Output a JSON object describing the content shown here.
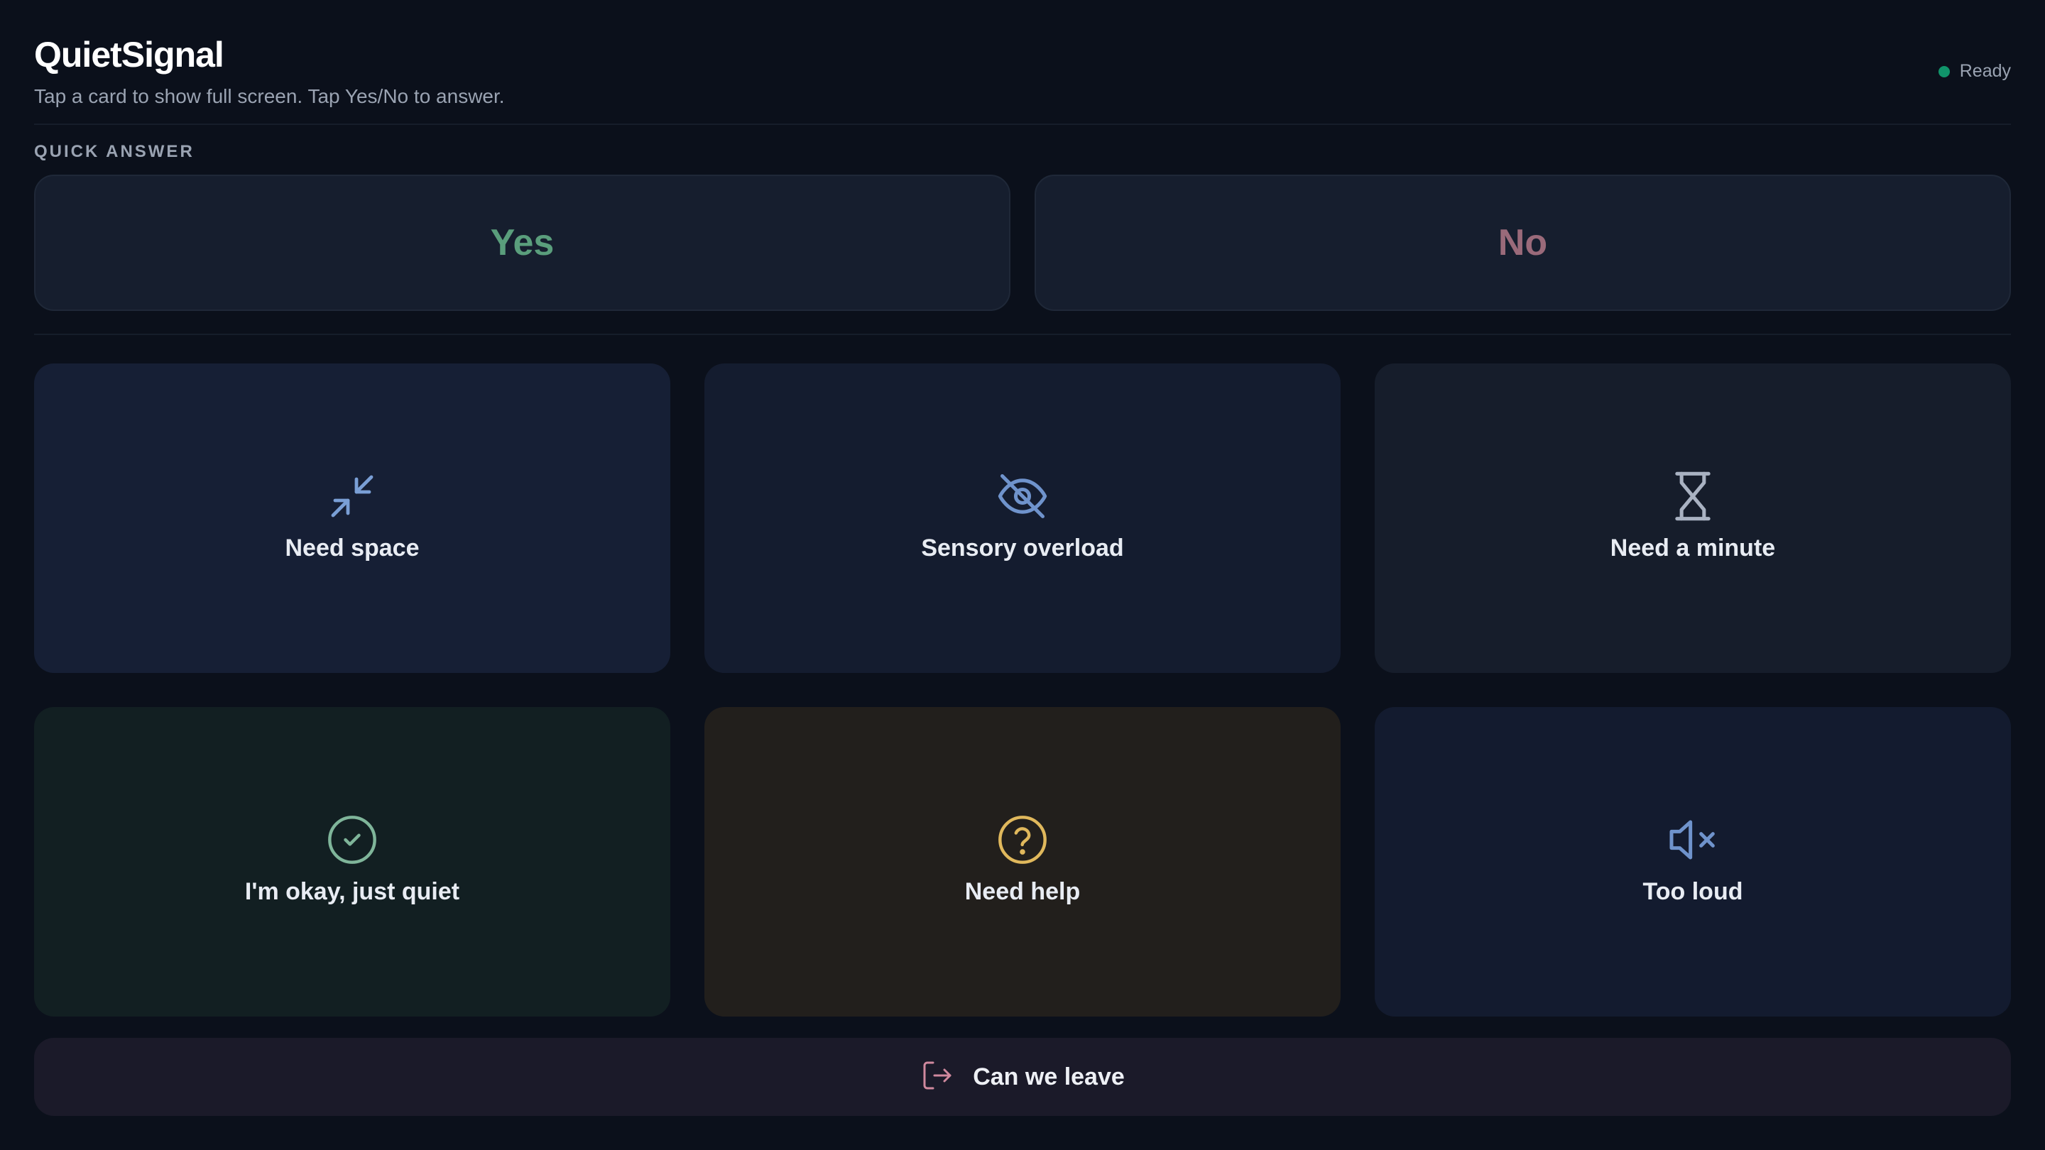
{
  "app": {
    "title": "QuietSignal",
    "subtitle": "Tap a card to show full screen. Tap Yes/No to answer.",
    "status": "Ready",
    "status_color": "#10946a"
  },
  "quick_answer": {
    "label": "QUICK ANSWER",
    "yes": "Yes",
    "no": "No",
    "yes_color": "#5a9e7c",
    "no_color": "#9a6a7a"
  },
  "cards": [
    {
      "label": "Need space",
      "icon": "minimize-arrows-icon",
      "background": "#161f35",
      "icon_color": "#7a9fd6"
    },
    {
      "label": "Sensory overload",
      "icon": "eye-off-icon",
      "background": "#141c2f",
      "icon_color": "#6f93cc"
    },
    {
      "label": "Need a minute",
      "icon": "hourglass-icon",
      "background": "#161d2b",
      "icon_color": "#a9b2c2"
    },
    {
      "label": "I'm okay, just quiet",
      "icon": "check-circle-icon",
      "background": "#121f22",
      "icon_color": "#7fb59a"
    },
    {
      "label": "Need help",
      "icon": "question-circle-icon",
      "background": "#221f1c",
      "icon_color": "#e0b85c"
    },
    {
      "label": "Too loud",
      "icon": "volume-mute-icon",
      "background": "#131b2f",
      "icon_color": "#6f93cc"
    }
  ],
  "leave": {
    "label": "Can we leave",
    "icon": "exit-icon",
    "icon_color": "#d0899e"
  }
}
